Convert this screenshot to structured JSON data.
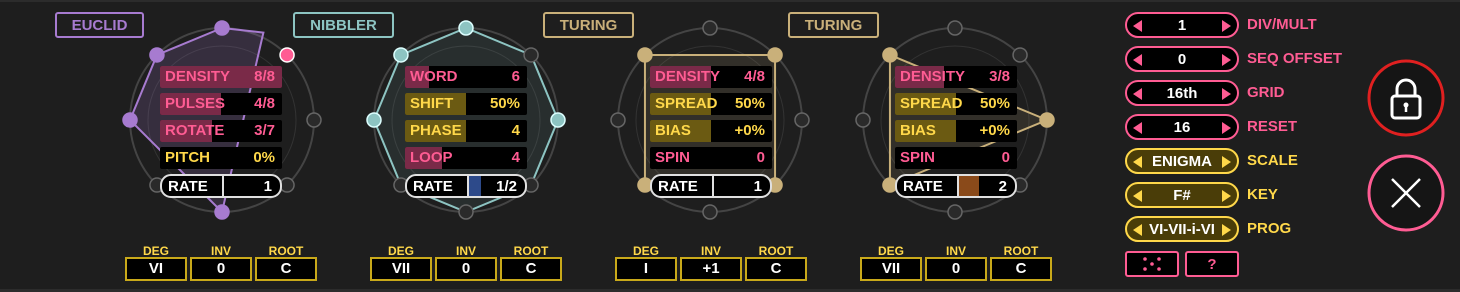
{
  "colors": {
    "pink": "#ff5c93",
    "yellow": "#ffd84a",
    "purple": "#a77bd0",
    "teal": "#8dc4c2",
    "tan": "#c9b07a",
    "white": "#e0e0e0",
    "red": "#e02020"
  },
  "sequencers": [
    {
      "mode": "EUCLID",
      "accent": "purple",
      "steps": 8,
      "active_steps": [
        1,
        2,
        3,
        4,
        5,
        6,
        7,
        8
      ],
      "params": [
        {
          "name": "DENSITY",
          "value": "8/8",
          "color": "pink",
          "fill": 1.0
        },
        {
          "name": "PULSES",
          "value": "4/8",
          "color": "pink",
          "fill": 0.5
        },
        {
          "name": "ROTATE",
          "value": "3/7",
          "color": "pink",
          "fill": 0.43
        },
        {
          "name": "PITCH",
          "value": "0%",
          "color": "yellow",
          "fill": 0.0
        }
      ],
      "rate": {
        "label": "RATE",
        "value": "1"
      },
      "deg": "VI",
      "inv": "0",
      "root": "C"
    },
    {
      "mode": "NIBBLER",
      "accent": "teal",
      "steps": 8,
      "params": [
        {
          "name": "WORD",
          "value": "6",
          "color": "pink",
          "fill": 0.2
        },
        {
          "name": "SHIFT",
          "value": "50%",
          "color": "yellow",
          "fill": 0.5
        },
        {
          "name": "PHASE",
          "value": "4",
          "color": "yellow",
          "fill": 0.5
        },
        {
          "name": "LOOP",
          "value": "4",
          "color": "pink",
          "fill": 0.3
        }
      ],
      "rate": {
        "label": "RATE",
        "value": "1/2"
      },
      "deg": "VII",
      "inv": "0",
      "root": "C"
    },
    {
      "mode": "TURING",
      "accent": "tan",
      "steps": 8,
      "params": [
        {
          "name": "DENSITY",
          "value": "4/8",
          "color": "pink",
          "fill": 0.5
        },
        {
          "name": "SPREAD",
          "value": "50%",
          "color": "yellow",
          "fill": 0.5
        },
        {
          "name": "BIAS",
          "value": "+0%",
          "color": "yellow",
          "fill": 0.5
        },
        {
          "name": "SPIN",
          "value": "0",
          "color": "pink",
          "fill": 0.0
        }
      ],
      "rate": {
        "label": "RATE",
        "value": "1"
      },
      "deg": "I",
      "inv": "+1",
      "root": "C"
    },
    {
      "mode": "TURING",
      "accent": "tan",
      "steps": 8,
      "params": [
        {
          "name": "DENSITY",
          "value": "3/8",
          "color": "pink",
          "fill": 0.4
        },
        {
          "name": "SPREAD",
          "value": "50%",
          "color": "yellow",
          "fill": 0.5
        },
        {
          "name": "BIAS",
          "value": "+0%",
          "color": "yellow",
          "fill": 0.5
        },
        {
          "name": "SPIN",
          "value": "0",
          "color": "pink",
          "fill": 0.0
        }
      ],
      "rate": {
        "label": "RATE",
        "value": "2"
      },
      "deg": "VII",
      "inv": "0",
      "root": "C"
    }
  ],
  "ctl_headers": {
    "deg": "DEG",
    "inv": "INV",
    "root": "ROOT"
  },
  "settings": [
    {
      "label": "DIV/MULT",
      "value": "1",
      "color": "pink"
    },
    {
      "label": "SEQ OFFSET",
      "value": "0",
      "color": "pink"
    },
    {
      "label": "GRID",
      "value": "16th",
      "color": "pink"
    },
    {
      "label": "RESET",
      "value": "16",
      "color": "pink"
    },
    {
      "label": "SCALE",
      "value": "ENIGMA",
      "color": "yellow"
    },
    {
      "label": "KEY",
      "value": "F#",
      "color": "yellow"
    },
    {
      "label": "PROG",
      "value": "VI-VII-i-VI",
      "color": "yellow"
    }
  ],
  "buttons": {
    "randomize": "dice-icon",
    "help": "?",
    "lock": "lock-icon",
    "close": "close-icon"
  }
}
